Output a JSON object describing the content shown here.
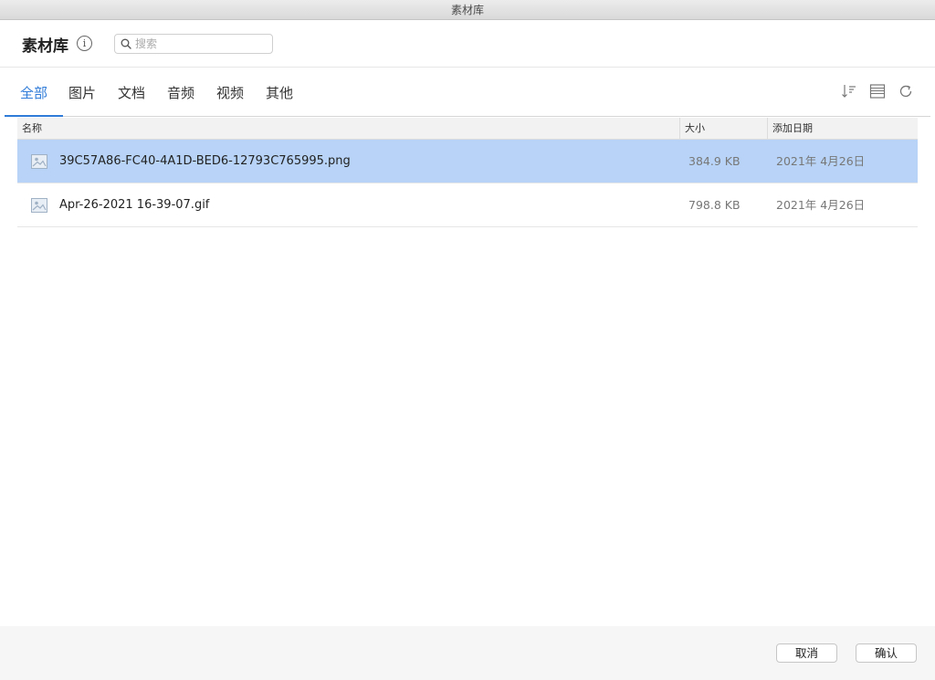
{
  "window": {
    "title": "素材库"
  },
  "header": {
    "title": "素材库",
    "info_glyph": "i",
    "search_placeholder": "搜索"
  },
  "tabs": [
    {
      "label": "全部",
      "active": true
    },
    {
      "label": "图片",
      "active": false
    },
    {
      "label": "文档",
      "active": false
    },
    {
      "label": "音频",
      "active": false
    },
    {
      "label": "视频",
      "active": false
    },
    {
      "label": "其他",
      "active": false
    }
  ],
  "toolbar": {
    "icons": [
      "sort-icon",
      "list-view-icon",
      "refresh-icon"
    ]
  },
  "table": {
    "columns": {
      "name": "名称",
      "size": "大小",
      "date": "添加日期"
    },
    "rows": [
      {
        "name": "39C57A86-FC40-4A1D-BED6-12793C765995.png",
        "size": "384.9 KB",
        "date": "2021年 4月26日",
        "selected": true
      },
      {
        "name": "Apr-26-2021 16-39-07.gif",
        "size": "798.8 KB",
        "date": "2021年 4月26日",
        "selected": false
      }
    ]
  },
  "footer": {
    "cancel_label": "取消",
    "confirm_label": "确认"
  },
  "colors": {
    "accent": "#2f7bd8",
    "selection": "#b8d3f7"
  }
}
